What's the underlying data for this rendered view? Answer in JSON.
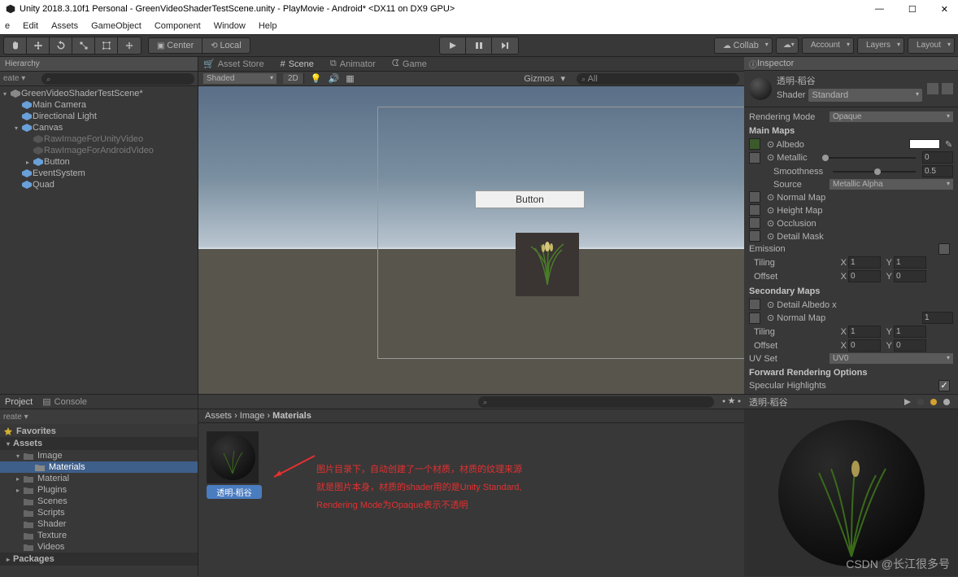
{
  "window": {
    "title": "Unity 2018.3.10f1 Personal - GreenVideoShaderTestScene.unity - PlayMovie - Android* <DX11 on DX9 GPU>"
  },
  "winControls": {
    "min": "—",
    "max": "☐",
    "close": "✕"
  },
  "menu": [
    "e",
    "Edit",
    "Assets",
    "GameObject",
    "Component",
    "Window",
    "Help"
  ],
  "pivot": {
    "center": "Center",
    "local": "Local"
  },
  "rightToolbar": {
    "collab": "Collab",
    "account": "Account",
    "layers": "Layers",
    "layout": "Layout"
  },
  "hierarchy": {
    "tab": "Hierarchy",
    "create": "eate ▾",
    "searchPlaceholder": "",
    "items": [
      {
        "label": "GreenVideoShaderTestScene*",
        "depth": 0,
        "expanded": true
      },
      {
        "label": "Main Camera",
        "depth": 1
      },
      {
        "label": "Directional Light",
        "depth": 1
      },
      {
        "label": "Canvas",
        "depth": 1,
        "expanded": true
      },
      {
        "label": "RawImageForUnityVideo",
        "depth": 2,
        "grey": true
      },
      {
        "label": "RawImageForAndroidVideo",
        "depth": 2,
        "grey": true
      },
      {
        "label": "Button",
        "depth": 2,
        "collapsed": true
      },
      {
        "label": "EventSystem",
        "depth": 1
      },
      {
        "label": "Quad",
        "depth": 1
      }
    ]
  },
  "sceneTabs": {
    "assetStore": "Asset Store",
    "scene": "Scene",
    "animator": "Animator",
    "game": "Game"
  },
  "sceneToolbar": {
    "shaded": "Shaded",
    "twoD": "2D",
    "gizmos": "Gizmos",
    "all": "All"
  },
  "sceneButton": "Button",
  "inspector": {
    "tab": "Inspector",
    "materialName": "透明-稻谷",
    "shaderLabel": "Shader",
    "shaderValue": "Standard",
    "renderingModeLabel": "Rendering Mode",
    "renderingModeValue": "Opaque",
    "mainMapsLabel": "Main Maps",
    "albedoLabel": "Albedo",
    "metallicLabel": "Metallic",
    "metallicValue": "0",
    "smoothnessLabel": "Smoothness",
    "smoothnessValue": "0.5",
    "sourceLabel": "Source",
    "sourceValue": "Metallic Alpha",
    "normalMapLabel": "Normal Map",
    "heightMapLabel": "Height Map",
    "occlusionLabel": "Occlusion",
    "detailMaskLabel": "Detail Mask",
    "emissionLabel": "Emission",
    "tilingLabel": "Tiling",
    "tilingX": "1",
    "tilingY": "1",
    "offsetLabel": "Offset",
    "offsetX": "0",
    "offsetY": "0",
    "secondaryMapsLabel": "Secondary Maps",
    "detailAlbedoLabel": "Detail Albedo x",
    "normalMap2Label": "Normal Map",
    "normalMap2Value": "1",
    "tiling2X": "1",
    "tiling2Y": "1",
    "offset2X": "0",
    "offset2Y": "0",
    "uvSetLabel": "UV Set",
    "uvSetValue": "UV0",
    "forwardLabel": "Forward Rendering Options",
    "specularLabel": "Specular Highlights"
  },
  "project": {
    "tabs": {
      "project": "Project",
      "console": "Console"
    },
    "create": "reate ▾",
    "favorites": "Favorites",
    "assets": "Assets",
    "tree": [
      {
        "label": "Image",
        "depth": 1,
        "expanded": true
      },
      {
        "label": "Materials",
        "depth": 2,
        "selected": true
      },
      {
        "label": "Material",
        "depth": 1
      },
      {
        "label": "Plugins",
        "depth": 1
      },
      {
        "label": "Scenes",
        "depth": 1
      },
      {
        "label": "Scripts",
        "depth": 1
      },
      {
        "label": "Shader",
        "depth": 1
      },
      {
        "label": "Texture",
        "depth": 1
      },
      {
        "label": "Videos",
        "depth": 1
      }
    ],
    "packages": "Packages"
  },
  "breadcrumb": {
    "assets": "Assets",
    "sep1": " › ",
    "image": "Image",
    "sep2": " › ",
    "materials": "Materials"
  },
  "assetGrid": {
    "item0": "透明-稻谷"
  },
  "annotation": {
    "line1": "图片目录下，自动创建了一个材质，材质的纹理来源",
    "line2": "就是图片本身，材质的shader用的是Unity Standard,",
    "line3": "Rendering Mode为Opaque表示不透明"
  },
  "preview": {
    "name": "透明-稻谷"
  },
  "watermark": "CSDN @长江很多号"
}
